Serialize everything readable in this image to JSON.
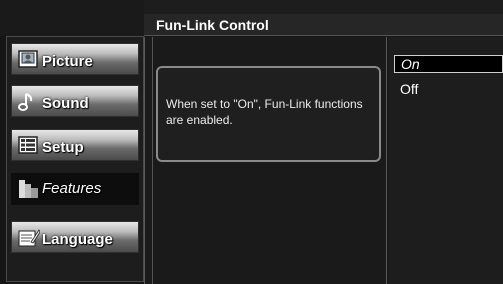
{
  "header": {
    "title": "Fun-Link Control"
  },
  "menu": {
    "items": [
      {
        "label": "Picture",
        "icon": "picture-icon"
      },
      {
        "label": "Sound",
        "icon": "sound-icon"
      },
      {
        "label": "Setup",
        "icon": "setup-icon"
      },
      {
        "label": "Features",
        "icon": "features-icon",
        "selected": true
      },
      {
        "label": "Language",
        "icon": "language-icon"
      }
    ]
  },
  "info": {
    "text": "When set to \"On\", Fun-Link functions are enabled."
  },
  "options": [
    {
      "label": "On",
      "selected": true
    },
    {
      "label": "Off",
      "selected": false
    }
  ]
}
